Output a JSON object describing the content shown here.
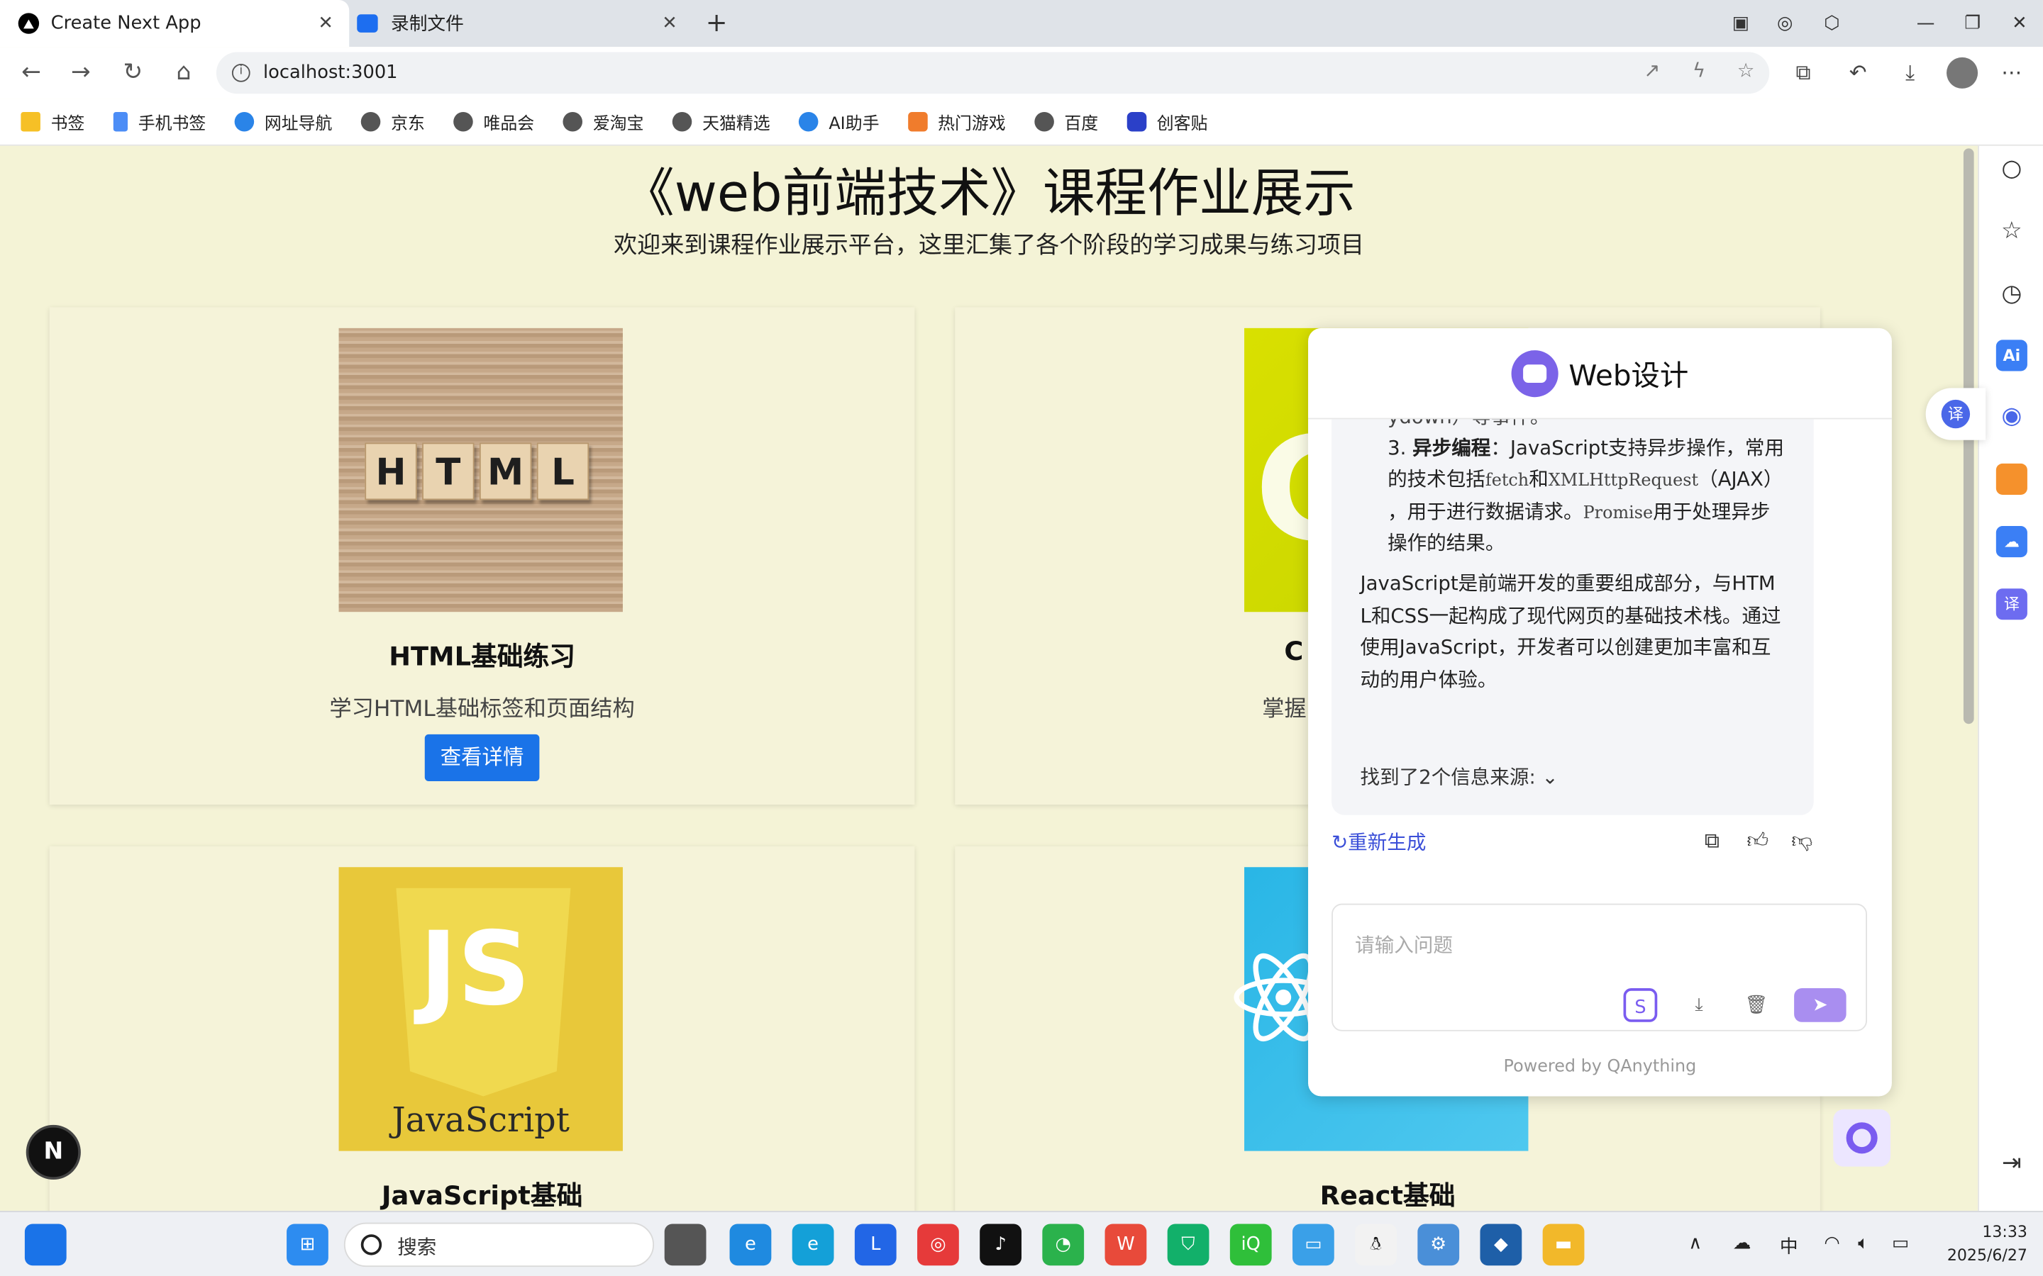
{
  "browser": {
    "tabs": [
      {
        "title": "Create Next App",
        "active": true
      },
      {
        "title": "录制文件",
        "active": false
      }
    ],
    "url": "localhost:3001",
    "bookmarks": [
      "书签",
      "手机书签",
      "网址导航",
      "京东",
      "唯品会",
      "爱淘宝",
      "天猫精选",
      "AI助手",
      "热门游戏",
      "百度",
      "创客贴"
    ]
  },
  "page": {
    "title": "《web前端技术》课程作业展示",
    "subtitle": "欢迎来到课程作业展示平台，这里汇集了各个阶段的学习成果与练习项目",
    "cards": [
      {
        "title": "HTML基础练习",
        "desc": "学习HTML基础标签和页面结构",
        "button": "查看详情",
        "image_text": [
          "H",
          "T",
          "M",
          "L"
        ]
      },
      {
        "title": "C",
        "desc": "掌握Fl"
      },
      {
        "title": "JavaScript基础",
        "image_text": "JavaScript"
      },
      {
        "title": "React基础"
      }
    ],
    "next_badge": "N"
  },
  "chat": {
    "title": "Web设计",
    "lines": {
      "cut": "ydown）等事件。",
      "item3_num": "3.",
      "item3_bold": "异步编程",
      "item3_a": "：JavaScript支持异步操作，常用",
      "item3_b1": "的技术包括",
      "item3_code1": "fetch",
      "item3_b2": "和",
      "item3_code2": "XMLHttpRequest",
      "item3_b3": "（AJAX）",
      "item3_c1": "，用于进行数据请求。",
      "item3_code3": "Promise",
      "item3_c2": "用于处理异步",
      "item3_d": "操作的结果。",
      "para1": "JavaScript是前端开发的重要组成部分，与HTM",
      "para2": "L和CSS一起构成了现代网页的基础技术栈。通过",
      "para3": "使用JavaScript，开发者可以创建更加丰富和互",
      "para4": "动的用户体验。"
    },
    "sources": "找到了2个信息来源:",
    "regenerate": "重新生成",
    "input_placeholder": "请输入问题",
    "powered_by": "Powered by QAnything"
  },
  "taskbar": {
    "search": "搜索",
    "ime": "中",
    "time": "13:33",
    "date": "2025/6/27"
  },
  "colors": {
    "page_bg": "#f4f3d6",
    "primary_button": "#1a73e8",
    "chat_accent": "#7b63e8",
    "regen_link": "#3b4fd8"
  }
}
